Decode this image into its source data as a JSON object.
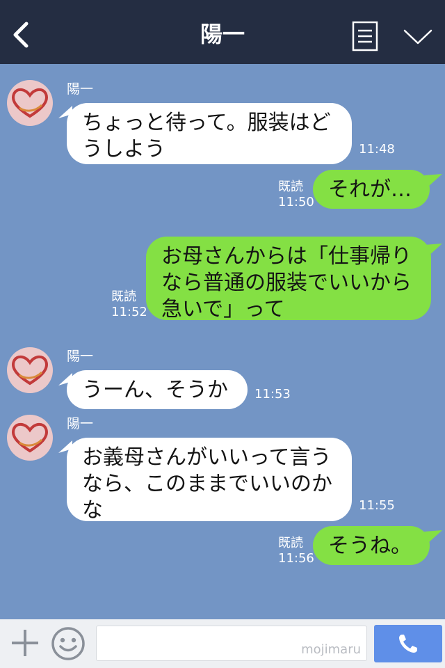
{
  "header": {
    "title": "陽一"
  },
  "messages": [
    {
      "direction": "in",
      "sender": "陽一",
      "text": "ちょっと待って。服装はど\nうしよう",
      "time": "11:48"
    },
    {
      "direction": "out",
      "text": "それが…",
      "read": "既読",
      "time": "11:50"
    },
    {
      "direction": "out",
      "text": "お母さんからは「仕事帰り\nなら普通の服装でいいから\n急いで」って",
      "read": "既読",
      "time": "11:52"
    },
    {
      "direction": "in",
      "sender": "陽一",
      "text": "うーん、そうか",
      "time": "11:53"
    },
    {
      "direction": "in",
      "sender": "陽一",
      "text": "お義母さんがいいって言う\nなら、このままでいいのか\nな",
      "time": "11:55"
    },
    {
      "direction": "out",
      "text": "そうね。",
      "read": "既読",
      "time": "11:56"
    }
  ],
  "input": {
    "watermark": "mojimaru"
  },
  "icons": {
    "back": "back-chevron-icon",
    "menu": "menu-list-icon",
    "more": "chevron-down-icon",
    "plus": "plus-icon",
    "emoji": "emoji-smile-icon",
    "call": "phone-icon"
  },
  "colors": {
    "header_bg": "#242d42",
    "chat_bg": "#7395c5",
    "bubble_in": "#ffffff",
    "bubble_out": "#84e044",
    "call_button": "#5f8fe8"
  }
}
